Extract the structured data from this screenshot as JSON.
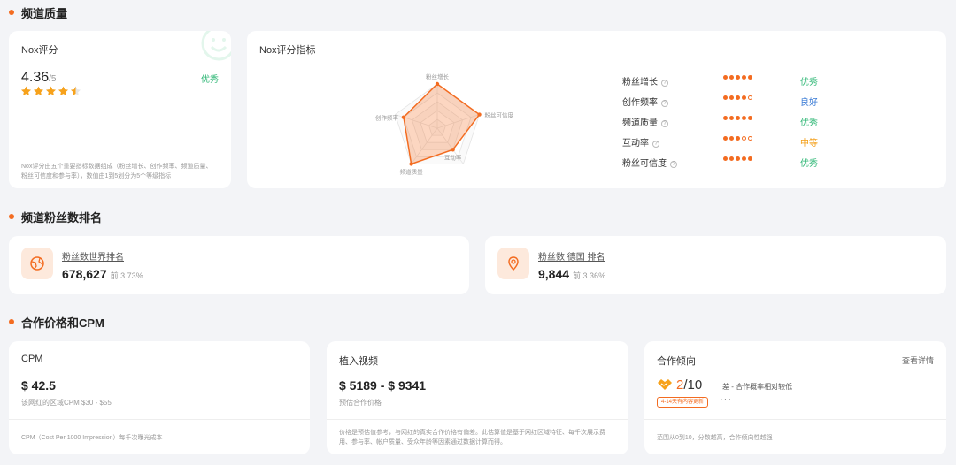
{
  "sections": {
    "quality": "频道质量",
    "ranking": "频道粉丝数排名",
    "pricing": "合作价格和CPM"
  },
  "nox_score": {
    "label": "Nox评分",
    "value": "4.36",
    "max": "/5",
    "grade": "优秀",
    "stars": 4.5,
    "description": "Nox评分由五个重要指标数据组成（粉丝增长、创作频率、频道质量、粉丝可信度和参与率），数值由1到5划分为5个等级指标"
  },
  "nox_metrics": {
    "title": "Nox评分指标",
    "radar_labels": [
      "粉丝增长",
      "粉丝可信度",
      "互动率",
      "频道质量",
      "创作频率"
    ],
    "radar_values": [
      5,
      5,
      3,
      5,
      4
    ],
    "items": [
      {
        "label": "粉丝增长",
        "level": 5,
        "grade": "优秀",
        "color": "#2bb673"
      },
      {
        "label": "创作频率",
        "level": 4,
        "grade": "良好",
        "color": "#3a7bd5"
      },
      {
        "label": "频道质量",
        "level": 5,
        "grade": "优秀",
        "color": "#2bb673"
      },
      {
        "label": "互动率",
        "level": 3,
        "grade": "中等",
        "color": "#f39c12"
      },
      {
        "label": "粉丝可信度",
        "level": 5,
        "grade": "优秀",
        "color": "#2bb673"
      }
    ]
  },
  "ranking": {
    "world": {
      "label": "粉丝数世界排名",
      "value": "678,627",
      "pct": "前 3.73%"
    },
    "country": {
      "label": "粉丝数 德国 排名",
      "value": "9,844",
      "pct": "前 3.36%"
    }
  },
  "cpm": {
    "label": "CPM",
    "value": "$ 42.5",
    "sub": "该网红的区域CPM $30 - $55",
    "footnote": "CPM（Cost Per 1000 Impression）每千次曝光成本"
  },
  "placement": {
    "label": "植入视频",
    "value": "$ 5189 - $ 9341",
    "sub": "预估合作价格",
    "footnote": "价格是预估值参考，与网红的真实合作价格有偏差。此估算值是基于网红区域特征、每千次展示费用、参与率、帐户质量、受众年龄等因素通过数据计算而得。"
  },
  "cooperation": {
    "label": "合作倾向",
    "link": "查看详情",
    "score": "2",
    "slash": "/",
    "max": "10",
    "note": "差 - 合作概率相对较低",
    "badge": "4-14天有内容更新",
    "more": "···",
    "footnote": "范围从0到10，分数越高，合作倾向性越强"
  },
  "colors": {
    "accent": "#f36c21",
    "good": "#2bb673",
    "fair": "#3a7bd5",
    "medium": "#f39c12"
  }
}
